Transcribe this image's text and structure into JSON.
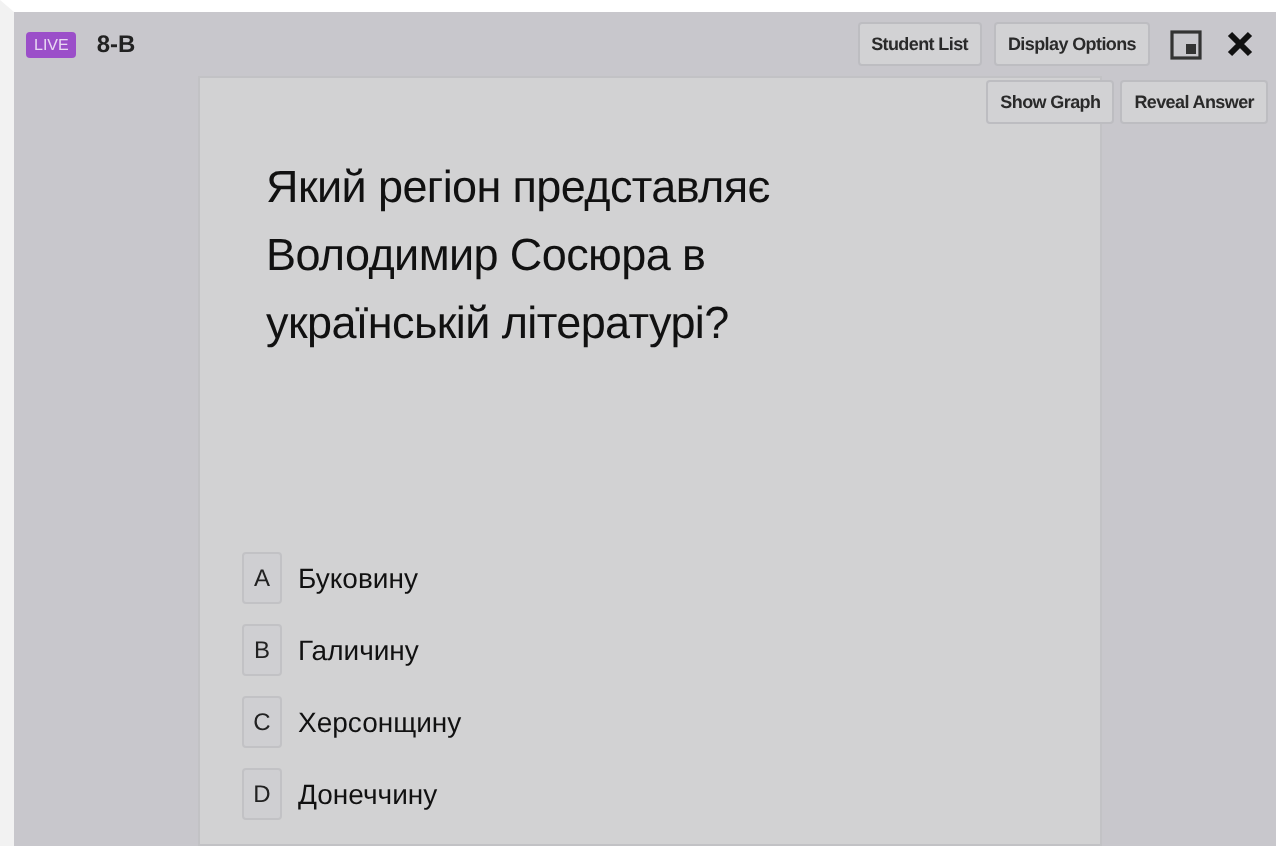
{
  "header": {
    "live_badge": "LIVE",
    "class_name": "8-B",
    "buttons": [
      "Student List",
      "Display Options"
    ]
  },
  "actions": [
    "Show Graph",
    "Reveal Answer"
  ],
  "question": "Який регіон представляє Володимир Сосюра в українській літературі?",
  "options": [
    {
      "letter": "A",
      "text": "Буковину"
    },
    {
      "letter": "B",
      "text": "Галичину"
    },
    {
      "letter": "C",
      "text": "Херсонщину"
    },
    {
      "letter": "D",
      "text": "Донеччину"
    }
  ]
}
